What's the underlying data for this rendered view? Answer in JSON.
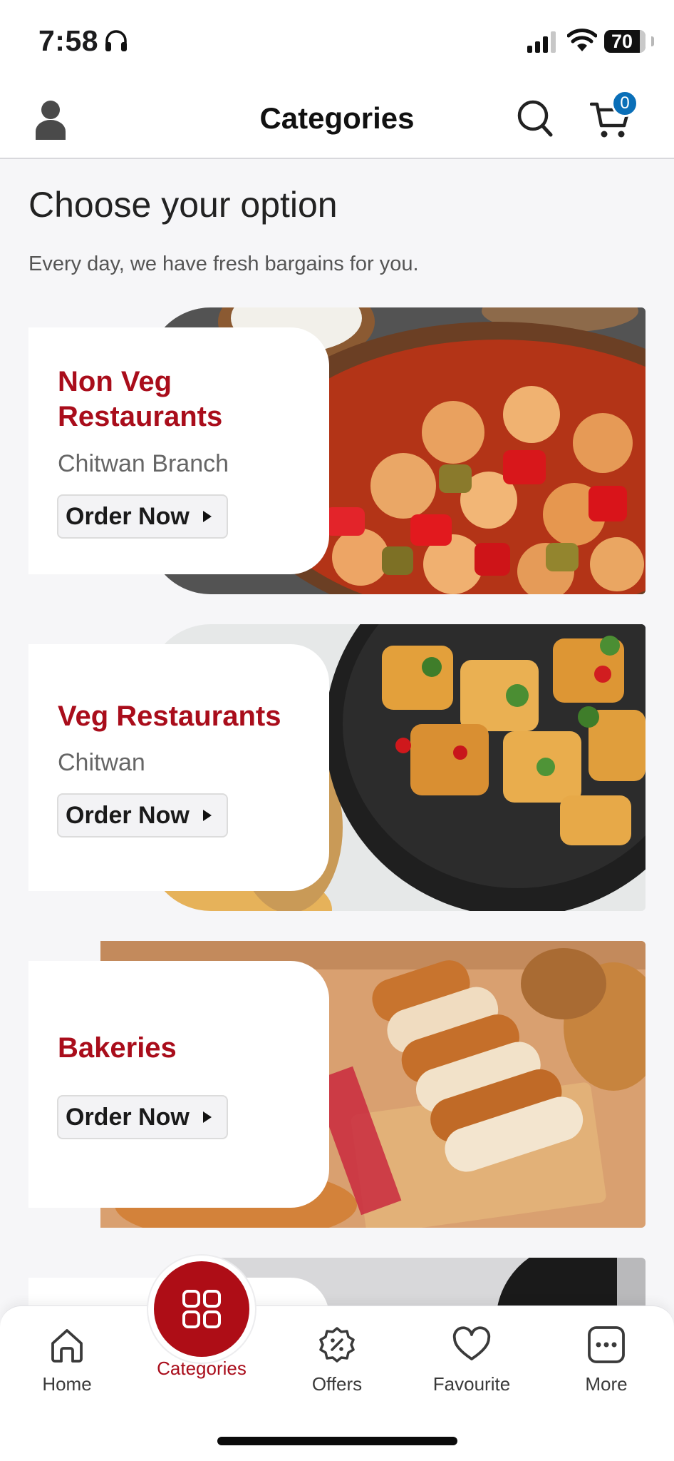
{
  "status_bar": {
    "time": "7:58",
    "battery": "70"
  },
  "header": {
    "title": "Categories",
    "cart_count": "0"
  },
  "intro": {
    "heading": "Choose your option",
    "subheading": "Every day, we have fresh bargains for you."
  },
  "categories": [
    {
      "title": "Non Veg Restaurants",
      "subtitle": "Chitwan Branch",
      "button": "Order Now",
      "image": "chicken-curry-dish-photo"
    },
    {
      "title": "Veg Restaurants",
      "subtitle": "Chitwan",
      "button": "Order Now",
      "image": "fried-tofu-dish-photo"
    },
    {
      "title": "Bakeries",
      "subtitle": "",
      "button": "Order Now",
      "image": "bread-and-croissants-photo"
    }
  ],
  "bottom_nav": {
    "items": [
      {
        "label": "Home",
        "icon": "home-icon"
      },
      {
        "label": "Categories",
        "icon": "grid-icon",
        "active": true
      },
      {
        "label": "Offers",
        "icon": "offer-badge-icon"
      },
      {
        "label": "Favourite",
        "icon": "heart-icon"
      },
      {
        "label": "More",
        "icon": "more-dots-icon"
      }
    ]
  },
  "colors": {
    "accent": "#a90d1b",
    "badge": "#0a6fb8",
    "background": "#f6f6f8"
  }
}
